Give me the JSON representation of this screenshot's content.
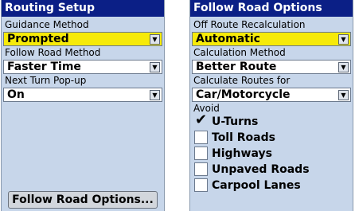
{
  "routing_setup": {
    "title": "Routing Setup",
    "guidance_method": {
      "label": "Guidance Method",
      "value": "Prompted"
    },
    "follow_road_method": {
      "label": "Follow Road Method",
      "value": "Faster Time"
    },
    "next_turn_popup": {
      "label": "Next Turn Pop-up",
      "value": "On"
    },
    "button_label": "Follow Road Options..."
  },
  "follow_road_options": {
    "title": "Follow Road Options",
    "off_route_recalc": {
      "label": "Off Route Recalculation",
      "value": "Automatic"
    },
    "calc_method": {
      "label": "Calculation Method",
      "value": "Better Route"
    },
    "calc_routes_for": {
      "label": "Calculate Routes for",
      "value": "Car/Motorcycle"
    },
    "avoid_label": "Avoid",
    "avoid_items": [
      {
        "label": "U-Turns",
        "checked": true
      },
      {
        "label": "Toll Roads",
        "checked": false
      },
      {
        "label": "Highways",
        "checked": false
      },
      {
        "label": "Unpaved Roads",
        "checked": false
      },
      {
        "label": "Carpool Lanes",
        "checked": false
      }
    ]
  },
  "colors": {
    "title_bar": "#0b1f86",
    "selected_field": "#f6ea09",
    "background": "#c7d6ea"
  },
  "icons": {
    "dropdown": "dropdown-arrow-icon",
    "check": "check-icon"
  }
}
